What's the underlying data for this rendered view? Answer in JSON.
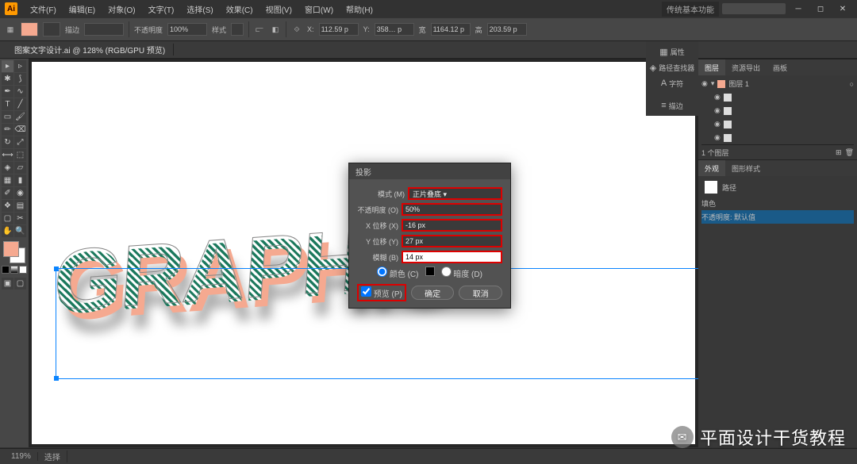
{
  "app": {
    "short": "Ai"
  },
  "menubar": {
    "items": [
      "文件(F)",
      "编辑(E)",
      "对象(O)",
      "文字(T)",
      "选择(S)",
      "效果(C)",
      "视图(V)",
      "窗口(W)",
      "帮助(H)"
    ]
  },
  "titlebar": {
    "mode": "传统基本功能"
  },
  "toolbar": {
    "stroke": "描边",
    "stroke_val": "",
    "opacity_label": "不透明度",
    "opacity_val": "100%",
    "style_label": "样式",
    "x_label": "X",
    "x_val": "112.59 p",
    "y_label": "Y",
    "y_val": "358… p",
    "w_label": "宽",
    "w_val": "1164.12 p",
    "h_label": "高",
    "h_val": "203.59 p"
  },
  "document": {
    "tab": "图案文字设计.ai @ 128% (RGB/GPU 预览)"
  },
  "artwork": {
    "text": "GRAPHIC"
  },
  "dialog": {
    "title": "投影",
    "mode_label": "模式 (M)",
    "mode_value": "正片叠底",
    "opacity_label": "不透明度 (O)",
    "opacity_value": "50%",
    "x_label": "X 位移 (X)",
    "x_value": "-16 px",
    "y_label": "Y 位移 (Y)",
    "y_value": "27 px",
    "blur_label": "模糊 (B)",
    "blur_value": "14 px",
    "radio_color": "颜色 (C)",
    "radio_dark": "暗度 (D)",
    "preview": "预览 (P)",
    "ok": "确定",
    "cancel": "取消"
  },
  "panels": {
    "layers_tabs": [
      "图层",
      "资源导出",
      "画板"
    ],
    "layer_root": "图层 1",
    "layer_count": "1 个图层",
    "libs_tabs": [
      "外观",
      "图形样式"
    ],
    "lib_path": "路径",
    "lib_fill": "填色",
    "lib_opacity": "不透明度: 默认值",
    "right_icons": [
      "属性",
      "路径查找器",
      "字符",
      "描边"
    ]
  },
  "statusbar": {
    "zoom": "119%",
    "tool": "选择"
  },
  "watermark": {
    "text": "平面设计干货教程"
  }
}
